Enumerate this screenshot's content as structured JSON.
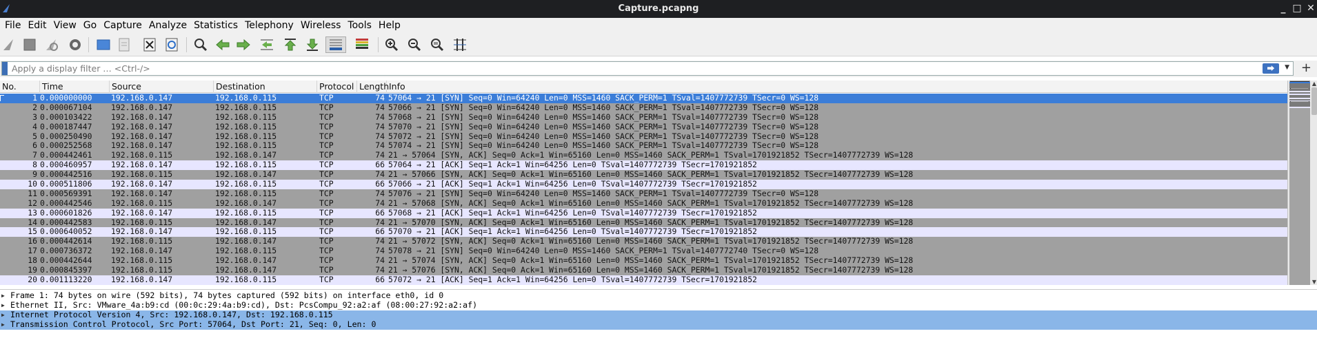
{
  "window": {
    "title": "Capture.pcapng",
    "controls": [
      "_",
      "□",
      "✕"
    ]
  },
  "menu": [
    {
      "label": "File"
    },
    {
      "label": "Edit"
    },
    {
      "label": "View"
    },
    {
      "label": "Go"
    },
    {
      "label": "Capture"
    },
    {
      "label": "Analyze"
    },
    {
      "label": "Statistics"
    },
    {
      "label": "Telephony"
    },
    {
      "label": "Wireless"
    },
    {
      "label": "Tools"
    },
    {
      "label": "Help"
    }
  ],
  "toolbar": {
    "icons": [
      "start-capture-icon",
      "stop-capture-icon",
      "restart-capture-icon",
      "capture-options-icon",
      "open-file-icon",
      "save-file-icon",
      "close-file-icon",
      "reload-file-icon",
      "find-packet-icon",
      "go-back-icon",
      "go-forward-icon",
      "go-to-packet-icon",
      "go-first-icon",
      "go-last-icon",
      "autoscroll-icon",
      "colorize-icon",
      "zoom-in-icon",
      "zoom-out-icon",
      "normal-size-icon",
      "resize-columns-icon"
    ]
  },
  "filter": {
    "placeholder": "Apply a display filter … <Ctrl-/>",
    "value": "",
    "apply_glyph": "⮕",
    "add_glyph": "+"
  },
  "packet_list": {
    "columns": [
      "No.",
      "Time",
      "Source",
      "Destination",
      "Protocol",
      "Length",
      "Info"
    ],
    "rows": [
      {
        "no": "1",
        "time": "0.000000000",
        "src": "192.168.0.147",
        "dst": "192.168.0.115",
        "proto": "TCP",
        "len": "74",
        "info": "57064 → 21 [SYN] Seq=0 Win=64240 Len=0 MSS=1460 SACK_PERM=1 TSval=1407772739 TSecr=0 WS=128",
        "style": "sel"
      },
      {
        "no": "2",
        "time": "0.000067104",
        "src": "192.168.0.147",
        "dst": "192.168.0.115",
        "proto": "TCP",
        "len": "74",
        "info": "57066 → 21 [SYN] Seq=0 Win=64240 Len=0 MSS=1460 SACK_PERM=1 TSval=1407772739 TSecr=0 WS=128",
        "style": "grey"
      },
      {
        "no": "3",
        "time": "0.000103422",
        "src": "192.168.0.147",
        "dst": "192.168.0.115",
        "proto": "TCP",
        "len": "74",
        "info": "57068 → 21 [SYN] Seq=0 Win=64240 Len=0 MSS=1460 SACK_PERM=1 TSval=1407772739 TSecr=0 WS=128",
        "style": "grey"
      },
      {
        "no": "4",
        "time": "0.000187447",
        "src": "192.168.0.147",
        "dst": "192.168.0.115",
        "proto": "TCP",
        "len": "74",
        "info": "57070 → 21 [SYN] Seq=0 Win=64240 Len=0 MSS=1460 SACK_PERM=1 TSval=1407772739 TSecr=0 WS=128",
        "style": "grey"
      },
      {
        "no": "5",
        "time": "0.000250490",
        "src": "192.168.0.147",
        "dst": "192.168.0.115",
        "proto": "TCP",
        "len": "74",
        "info": "57072 → 21 [SYN] Seq=0 Win=64240 Len=0 MSS=1460 SACK_PERM=1 TSval=1407772739 TSecr=0 WS=128",
        "style": "grey"
      },
      {
        "no": "6",
        "time": "0.000252568",
        "src": "192.168.0.147",
        "dst": "192.168.0.115",
        "proto": "TCP",
        "len": "74",
        "info": "57074 → 21 [SYN] Seq=0 Win=64240 Len=0 MSS=1460 SACK_PERM=1 TSval=1407772739 TSecr=0 WS=128",
        "style": "grey"
      },
      {
        "no": "7",
        "time": "0.000442461",
        "src": "192.168.0.115",
        "dst": "192.168.0.147",
        "proto": "TCP",
        "len": "74",
        "info": "21 → 57064 [SYN, ACK] Seq=0 Ack=1 Win=65160 Len=0 MSS=1460 SACK_PERM=1 TSval=1701921852 TSecr=1407772739 WS=128",
        "style": "grey"
      },
      {
        "no": "8",
        "time": "0.000460957",
        "src": "192.168.0.147",
        "dst": "192.168.0.115",
        "proto": "TCP",
        "len": "66",
        "info": "57064 → 21 [ACK] Seq=1 Ack=1 Win=64256 Len=0 TSval=1407772739 TSecr=1701921852",
        "style": "light"
      },
      {
        "no": "9",
        "time": "0.000442516",
        "src": "192.168.0.115",
        "dst": "192.168.0.147",
        "proto": "TCP",
        "len": "74",
        "info": "21 → 57066 [SYN, ACK] Seq=0 Ack=1 Win=65160 Len=0 MSS=1460 SACK_PERM=1 TSval=1701921852 TSecr=1407772739 WS=128",
        "style": "grey"
      },
      {
        "no": "10",
        "time": "0.000511806",
        "src": "192.168.0.147",
        "dst": "192.168.0.115",
        "proto": "TCP",
        "len": "66",
        "info": "57066 → 21 [ACK] Seq=1 Ack=1 Win=64256 Len=0 TSval=1407772739 TSecr=1701921852",
        "style": "light"
      },
      {
        "no": "11",
        "time": "0.000569391",
        "src": "192.168.0.147",
        "dst": "192.168.0.115",
        "proto": "TCP",
        "len": "74",
        "info": "57076 → 21 [SYN] Seq=0 Win=64240 Len=0 MSS=1460 SACK_PERM=1 TSval=1407772739 TSecr=0 WS=128",
        "style": "grey"
      },
      {
        "no": "12",
        "time": "0.000442546",
        "src": "192.168.0.115",
        "dst": "192.168.0.147",
        "proto": "TCP",
        "len": "74",
        "info": "21 → 57068 [SYN, ACK] Seq=0 Ack=1 Win=65160 Len=0 MSS=1460 SACK_PERM=1 TSval=1701921852 TSecr=1407772739 WS=128",
        "style": "grey"
      },
      {
        "no": "13",
        "time": "0.000601826",
        "src": "192.168.0.147",
        "dst": "192.168.0.115",
        "proto": "TCP",
        "len": "66",
        "info": "57068 → 21 [ACK] Seq=1 Ack=1 Win=64256 Len=0 TSval=1407772739 TSecr=1701921852",
        "style": "light"
      },
      {
        "no": "14",
        "time": "0.000442583",
        "src": "192.168.0.115",
        "dst": "192.168.0.147",
        "proto": "TCP",
        "len": "74",
        "info": "21 → 57070 [SYN, ACK] Seq=0 Ack=1 Win=65160 Len=0 MSS=1460 SACK_PERM=1 TSval=1701921852 TSecr=1407772739 WS=128",
        "style": "grey"
      },
      {
        "no": "15",
        "time": "0.000640052",
        "src": "192.168.0.147",
        "dst": "192.168.0.115",
        "proto": "TCP",
        "len": "66",
        "info": "57070 → 21 [ACK] Seq=1 Ack=1 Win=64256 Len=0 TSval=1407772739 TSecr=1701921852",
        "style": "light"
      },
      {
        "no": "16",
        "time": "0.000442614",
        "src": "192.168.0.115",
        "dst": "192.168.0.147",
        "proto": "TCP",
        "len": "74",
        "info": "21 → 57072 [SYN, ACK] Seq=0 Ack=1 Win=65160 Len=0 MSS=1460 SACK_PERM=1 TSval=1701921852 TSecr=1407772739 WS=128",
        "style": "grey"
      },
      {
        "no": "17",
        "time": "0.000736372",
        "src": "192.168.0.147",
        "dst": "192.168.0.115",
        "proto": "TCP",
        "len": "74",
        "info": "57078 → 21 [SYN] Seq=0 Win=64240 Len=0 MSS=1460 SACK_PERM=1 TSval=1407772740 TSecr=0 WS=128",
        "style": "grey"
      },
      {
        "no": "18",
        "time": "0.000442644",
        "src": "192.168.0.115",
        "dst": "192.168.0.147",
        "proto": "TCP",
        "len": "74",
        "info": "21 → 57074 [SYN, ACK] Seq=0 Ack=1 Win=65160 Len=0 MSS=1460 SACK_PERM=1 TSval=1701921852 TSecr=1407772739 WS=128",
        "style": "grey"
      },
      {
        "no": "19",
        "time": "0.000845397",
        "src": "192.168.0.115",
        "dst": "192.168.0.147",
        "proto": "TCP",
        "len": "74",
        "info": "21 → 57076 [SYN, ACK] Seq=0 Ack=1 Win=65160 Len=0 MSS=1460 SACK_PERM=1 TSval=1701921852 TSecr=1407772739 WS=128",
        "style": "grey"
      },
      {
        "no": "20",
        "time": "0.001113220",
        "src": "192.168.0.147",
        "dst": "192.168.0.115",
        "proto": "TCP",
        "len": "66",
        "info": "57072 → 21 [ACK] Seq=1 Ack=1 Win=64256 Len=0 TSval=1407772739 TSecr=1701921852",
        "style": "light"
      }
    ]
  },
  "details": [
    {
      "text": "Frame 1: 74 bytes on wire (592 bits), 74 bytes captured (592 bits) on interface eth0, id 0",
      "highlight": false
    },
    {
      "text": "Ethernet II, Src: VMware_4a:b9:cd (00:0c:29:4a:b9:cd), Dst: PcsCompu_92:a2:af (08:00:27:92:a2:af)",
      "highlight": false
    },
    {
      "text": "Internet Protocol Version 4, Src: 192.168.0.147, Dst: 192.168.0.115",
      "highlight": true
    },
    {
      "text": "Transmission Control Protocol, Src Port: 57064, Dst Port: 21, Seq: 0, Len: 0",
      "highlight": true
    }
  ],
  "colors": {
    "selected_row": "#3b7dd8",
    "tcp_syn_row": "#a0a0a0",
    "tcp_row": "#e7e6ff",
    "detail_highlight": "#8ab6e8"
  }
}
